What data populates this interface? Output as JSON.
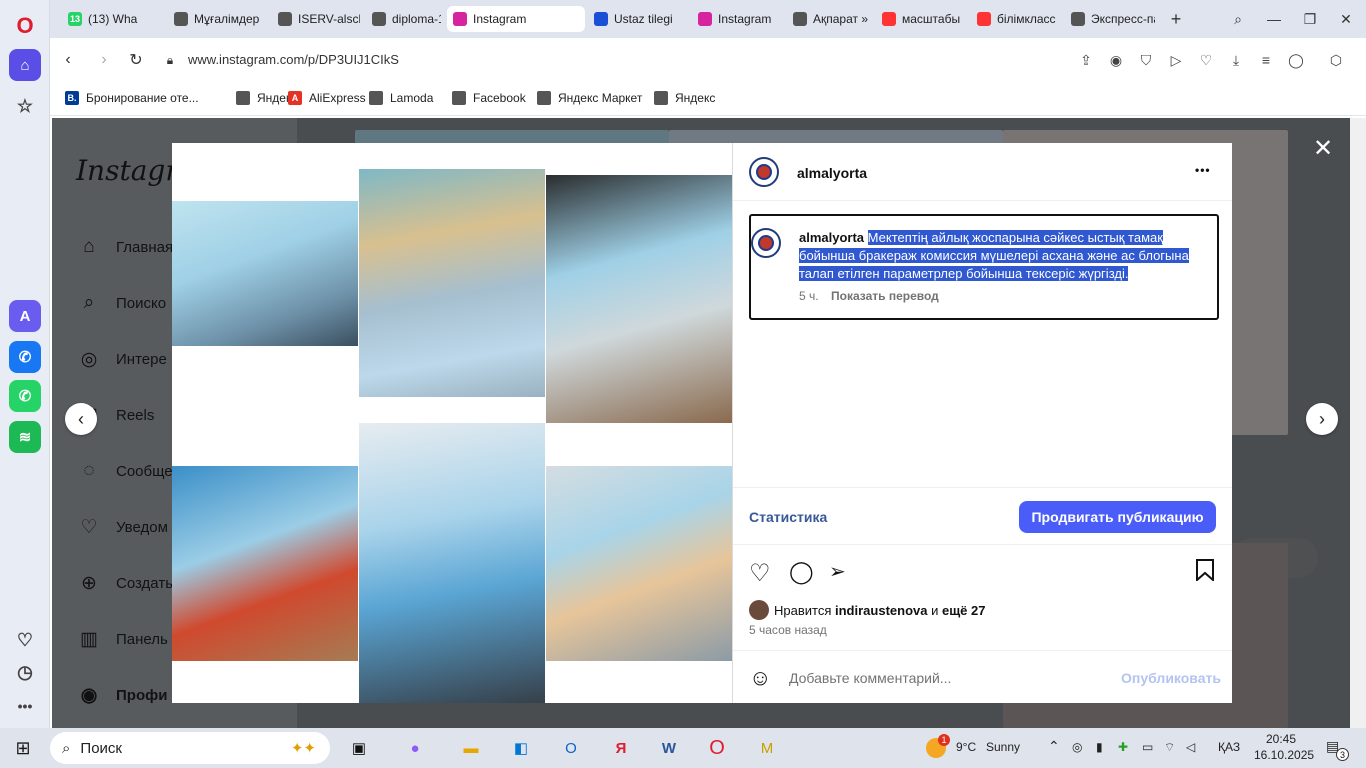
{
  "tabs": [
    {
      "label": "(13) Wha",
      "badge": "13",
      "fav": "#25d366",
      "active": false
    },
    {
      "label": "Мұғалімдер",
      "fav": "#555",
      "active": false
    },
    {
      "label": "ISERV-alsch",
      "fav": "#555",
      "active": false
    },
    {
      "label": "diploma-17!",
      "fav": "#555",
      "active": false
    },
    {
      "label": "Instagram",
      "fav": "#d6249f",
      "active": true
    },
    {
      "label": "Ustaz tilegi",
      "fav": "#1b4fd8",
      "active": false
    },
    {
      "label": "Instagram",
      "fav": "#d6249f",
      "active": false
    },
    {
      "label": "Ақпарат » Ж",
      "fav": "#555",
      "active": false
    },
    {
      "label": "масштабы",
      "fav": "#ff3333",
      "active": false
    },
    {
      "label": "білімкласс",
      "fav": "#ff3333",
      "active": false
    },
    {
      "label": "Экспресс-па",
      "fav": "#555",
      "active": false
    }
  ],
  "address": {
    "url": "www.instagram.com/p/DP3UIJ1CIkS"
  },
  "bookmarks": [
    {
      "label": "Бронирование оте...",
      "icon": "B.",
      "color": "#003b95"
    },
    {
      "label": "Яндекс",
      "icon": "",
      "color": "#555"
    },
    {
      "label": "AliExpress",
      "icon": "A",
      "color": "#e43225"
    },
    {
      "label": "Lamoda",
      "icon": "",
      "color": "#555"
    },
    {
      "label": "Facebook",
      "icon": "",
      "color": "#555"
    },
    {
      "label": "Яндекс Маркет",
      "icon": "",
      "color": "#555"
    },
    {
      "label": "Яндекс",
      "icon": "",
      "color": "#555"
    }
  ],
  "instagram_sidebar": {
    "logo": "Instagram",
    "items": [
      {
        "label": "Главная",
        "icon": "home-icon"
      },
      {
        "label": "Поиско",
        "icon": "search-icon"
      },
      {
        "label": "Интере",
        "icon": "compass-icon"
      },
      {
        "label": "Reels",
        "icon": "reels-icon"
      },
      {
        "label": "Сообще",
        "icon": "messenger-icon"
      },
      {
        "label": "Уведом",
        "icon": "heart-icon"
      },
      {
        "label": "Создать",
        "icon": "plus-icon"
      },
      {
        "label": "Панель",
        "icon": "dashboard-icon"
      },
      {
        "label": "Профи",
        "icon": "profile-icon"
      }
    ]
  },
  "post": {
    "username": "almalyorta",
    "caption_user": "almalyorta",
    "caption": "Мектептің айлық жоспарына сәйкес ыстық тамақ бойынша бракераж комиссия мүшелері асхана және ас блогына талап етілген параметрлер бойынша тексеріс жүргізді.",
    "age": "5 ч.",
    "translate": "Показать перевод",
    "statistics": "Статистика",
    "promote": "Продвигать публикацию",
    "likes_prefix": "Нравится",
    "likes_user": "indiraustenova",
    "likes_and": "и",
    "likes_more": "ещё 27",
    "time_ago": "5 часов назад",
    "comment_placeholder": "Добавьте комментарий...",
    "publish": "Опубликовать",
    "more_dots": "•••"
  },
  "taskbar": {
    "search": "Поиск",
    "weather_temp": "9°C",
    "weather_text": "Sunny",
    "lang": "ҚАЗ",
    "time": "20:45",
    "date": "16.10.2025",
    "notifications": "3",
    "weather_badge": "1"
  },
  "colors": {
    "accent": "#4a5df9",
    "link": "#385898",
    "selection": "#2f58d1"
  }
}
